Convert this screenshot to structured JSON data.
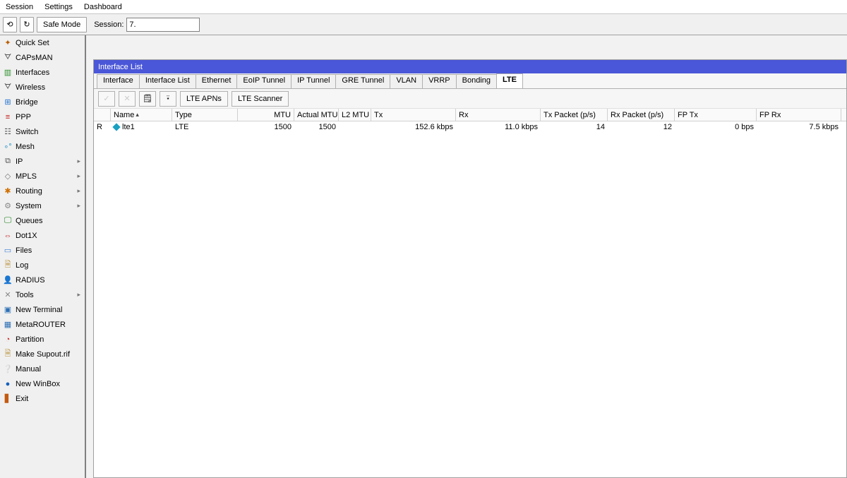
{
  "menubar": {
    "session": "Session",
    "settings": "Settings",
    "dashboard": "Dashboard"
  },
  "toolbar": {
    "safe": "Safe Mode",
    "session_label": "Session:",
    "session_value": "7."
  },
  "sidebar": {
    "items": [
      {
        "label": "Quick Set"
      },
      {
        "label": "CAPsMAN"
      },
      {
        "label": "Interfaces"
      },
      {
        "label": "Wireless"
      },
      {
        "label": "Bridge"
      },
      {
        "label": "PPP"
      },
      {
        "label": "Switch"
      },
      {
        "label": "Mesh"
      },
      {
        "label": "IP",
        "sub": true
      },
      {
        "label": "MPLS",
        "sub": true
      },
      {
        "label": "Routing",
        "sub": true
      },
      {
        "label": "System",
        "sub": true
      },
      {
        "label": "Queues"
      },
      {
        "label": "Dot1X"
      },
      {
        "label": "Files"
      },
      {
        "label": "Log"
      },
      {
        "label": "RADIUS"
      },
      {
        "label": "Tools",
        "sub": true
      },
      {
        "label": "New Terminal"
      },
      {
        "label": "MetaROUTER"
      },
      {
        "label": "Partition"
      },
      {
        "label": "Make Supout.rif"
      },
      {
        "label": "Manual"
      },
      {
        "label": "New WinBox"
      },
      {
        "label": "Exit"
      }
    ]
  },
  "win": {
    "title": "Interface List",
    "tabs": [
      "Interface",
      "Interface List",
      "Ethernet",
      "EoIP Tunnel",
      "IP Tunnel",
      "GRE Tunnel",
      "VLAN",
      "VRRP",
      "Bonding",
      "LTE"
    ],
    "active_tab": "LTE",
    "btn_apns": "LTE APNs",
    "btn_scanner": "LTE Scanner",
    "headers": [
      "",
      "Name",
      "Type",
      "MTU",
      "Actual MTU",
      "L2 MTU",
      "Tx",
      "Rx",
      "Tx Packet (p/s)",
      "Rx Packet (p/s)",
      "FP Tx",
      "FP Rx"
    ],
    "row": {
      "flag": "R",
      "name": "lte1",
      "type": "LTE",
      "mtu": "1500",
      "amtu": "1500",
      "l2mtu": "",
      "tx": "152.6 kbps",
      "rx": "11.0 kbps",
      "txp": "14",
      "rxp": "12",
      "fptx": "0 bps",
      "fprx": "7.5 kbps"
    }
  }
}
